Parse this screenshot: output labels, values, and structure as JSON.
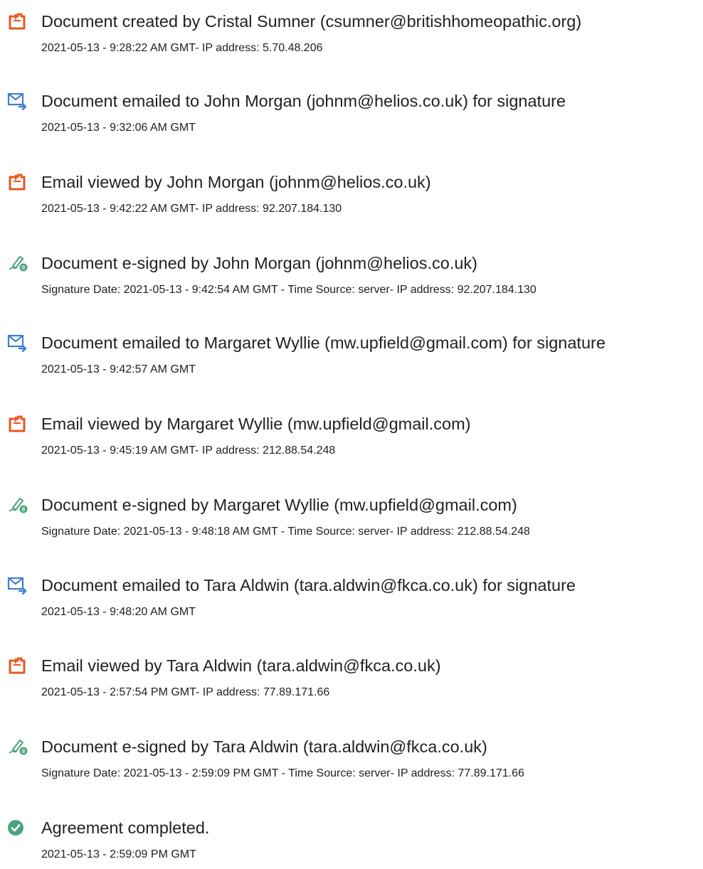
{
  "colors": {
    "pdf_icon": "#e8571f",
    "email_icon": "#3f7fd1",
    "esign_icon": "#4ba37c",
    "complete_icon": "#4ba37c",
    "title_text": "#222222",
    "detail_text": "#1f1f1f"
  },
  "events": [
    {
      "icon": "document-icon",
      "title": "Document created by Cristal Sumner (csumner@britishhomeopathic.org)",
      "detail": "2021-05-13 - 9:28:22 AM GMT- IP address: 5.70.48.206"
    },
    {
      "icon": "email-sent-icon",
      "title": "Document emailed to John Morgan (johnm@helios.co.uk) for signature",
      "detail": "2021-05-13 - 9:32:06 AM GMT"
    },
    {
      "icon": "document-icon",
      "title": "Email viewed by John Morgan (johnm@helios.co.uk)",
      "detail": "2021-05-13 - 9:42:22 AM GMT- IP address: 92.207.184.130"
    },
    {
      "icon": "esign-pen-icon",
      "title": "Document e-signed by John Morgan (johnm@helios.co.uk)",
      "detail": "Signature Date: 2021-05-13 - 9:42:54 AM GMT - Time Source: server- IP address: 92.207.184.130"
    },
    {
      "icon": "email-sent-icon",
      "title": "Document emailed to Margaret Wyllie (mw.upfield@gmail.com) for signature",
      "detail": "2021-05-13 - 9:42:57 AM GMT"
    },
    {
      "icon": "document-icon",
      "title": "Email viewed by Margaret Wyllie (mw.upfield@gmail.com)",
      "detail": "2021-05-13 - 9:45:19 AM GMT- IP address: 212.88.54.248"
    },
    {
      "icon": "esign-pen-icon",
      "title": "Document e-signed by Margaret Wyllie (mw.upfield@gmail.com)",
      "detail": "Signature Date: 2021-05-13 - 9:48:18 AM GMT - Time Source: server- IP address: 212.88.54.248"
    },
    {
      "icon": "email-sent-icon",
      "title": "Document emailed to Tara Aldwin (tara.aldwin@fkca.co.uk) for signature",
      "detail": "2021-05-13 - 9:48:20 AM GMT"
    },
    {
      "icon": "document-icon",
      "title": "Email viewed by Tara Aldwin (tara.aldwin@fkca.co.uk)",
      "detail": "2021-05-13 - 2:57:54 PM GMT- IP address: 77.89.171.66"
    },
    {
      "icon": "esign-pen-icon",
      "title": "Document e-signed by Tara Aldwin (tara.aldwin@fkca.co.uk)",
      "detail": "Signature Date: 2021-05-13 - 2:59:09 PM GMT - Time Source: server- IP address: 77.89.171.66"
    },
    {
      "icon": "check-circle-icon",
      "title": "Agreement completed.",
      "detail": "2021-05-13 - 2:59:09 PM GMT"
    }
  ]
}
